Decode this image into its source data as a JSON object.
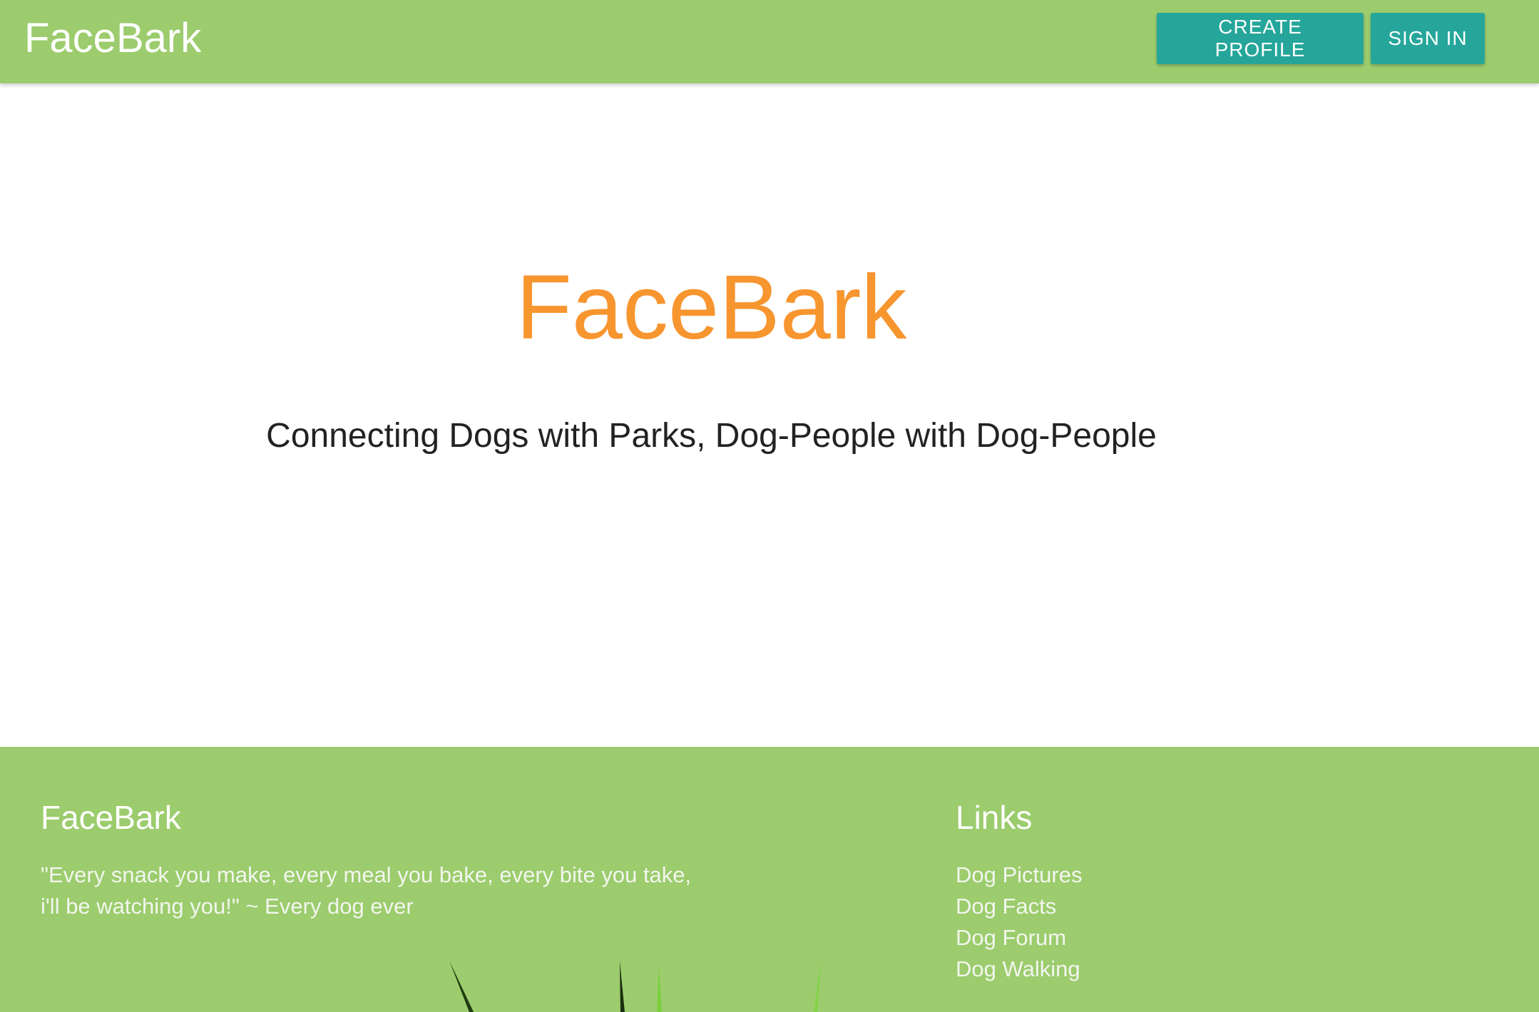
{
  "navbar": {
    "brand": "FaceBark",
    "create_profile_label": "CREATE PROFILE",
    "sign_in_label": "SIGN IN"
  },
  "hero": {
    "title": "FaceBark",
    "tagline": "Connecting Dogs with Parks, Dog-People with Dog-People"
  },
  "footer": {
    "brand_title": "FaceBark",
    "quote_line1": "\"Every snack you make, every meal you bake, every bite you take,",
    "quote_line2": "i'll be watching you!\" ~ Every dog ever",
    "links_title": "Links",
    "links": [
      "Dog Pictures",
      "Dog Facts",
      "Dog Forum",
      "Dog Walking"
    ]
  },
  "colors": {
    "bar_green": "#9ccc6d",
    "button_teal": "#26a69a",
    "hero_orange": "#f7952f"
  },
  "icons": {
    "grass_decoration": "grass-blades-icon"
  }
}
